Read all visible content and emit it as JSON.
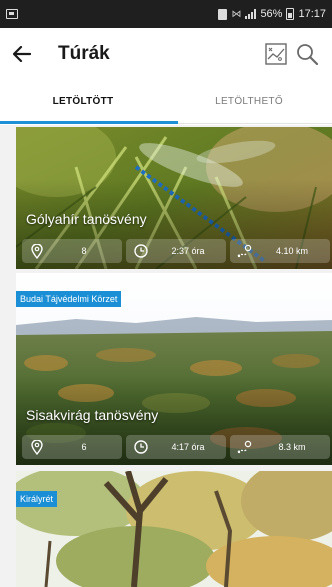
{
  "status_bar": {
    "battery_percent": "56%",
    "time": "17:17"
  },
  "app_bar": {
    "title": "Túrák"
  },
  "tabs": [
    {
      "label": "LETÖLTÖTT",
      "active": true
    },
    {
      "label": "LETÖLTHETŐ",
      "active": false
    }
  ],
  "tours": [
    {
      "name": "Gólyahír tanösvény",
      "badge": "",
      "poi_count": "8",
      "duration": "2:37 óra",
      "distance": "4.10 km"
    },
    {
      "name": "Sisakvirág tanösvény",
      "badge": "Budai Tájvédelmi Körzet",
      "poi_count": "6",
      "duration": "4:17 óra",
      "distance": "8.3 km"
    },
    {
      "name": "",
      "badge": "Királyrét",
      "poi_count": "",
      "duration": "",
      "distance": ""
    }
  ],
  "colors": {
    "accent": "#1e90d8",
    "badge": "#1b8fd6",
    "status_bar": "#1f1f1f"
  },
  "icons": {
    "status": [
      "notification-icon",
      "sim-icon",
      "vibrate-icon",
      "signal-icon",
      "battery-icon"
    ],
    "app_bar": [
      "back-arrow-icon",
      "map-icon",
      "search-icon"
    ],
    "stats": [
      "location-pin-icon",
      "clock-icon",
      "route-distance-icon"
    ]
  }
}
